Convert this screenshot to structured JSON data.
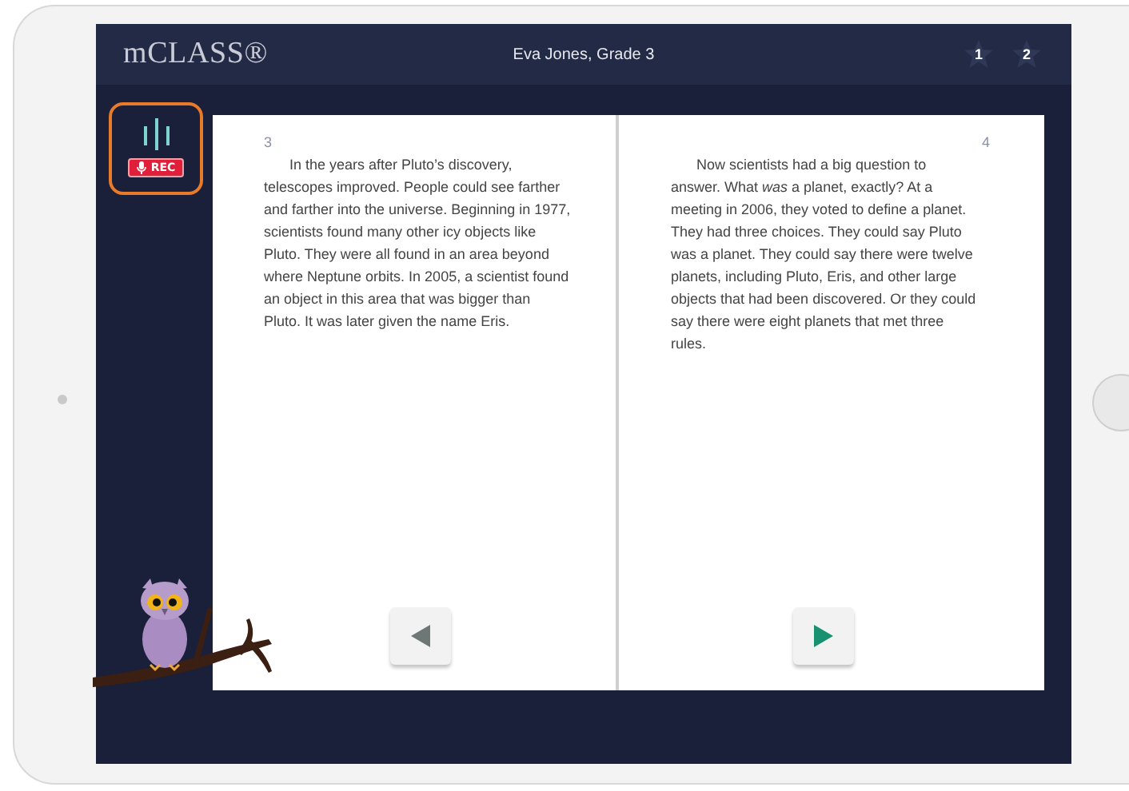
{
  "header": {
    "logo": "mCLASS®",
    "student": "Eva Jones, Grade 3",
    "stars": [
      {
        "label": "1"
      },
      {
        "label": "2"
      }
    ]
  },
  "recorder": {
    "label": "REC",
    "recording": true
  },
  "pages": [
    {
      "number": "3",
      "text": "In the years after Pluto’s discovery, telescopes improved. People could see farther and farther into the universe. Beginning in 1977, scientists found many other icy objects like Pluto. They were all found in an area beyond where Neptune orbits. In 2005, a scientist found an object in this area that was bigger than Pluto. It was later given the name Eris.",
      "nav": {
        "kind": "previous",
        "disabled": true
      }
    },
    {
      "number": "4",
      "text": "Now scientists had a big question to answer. What *was* a planet, exactly? At a meeting in 2006, they voted to define a planet. They had three choices. They could say Pluto was a planet. They could say there were twelve planets, including Pluto, Eris, and other large objects that had been discovered. Or they could say there were eight planets that met three rules.",
      "nav": {
        "kind": "next",
        "disabled": false
      }
    }
  ]
}
